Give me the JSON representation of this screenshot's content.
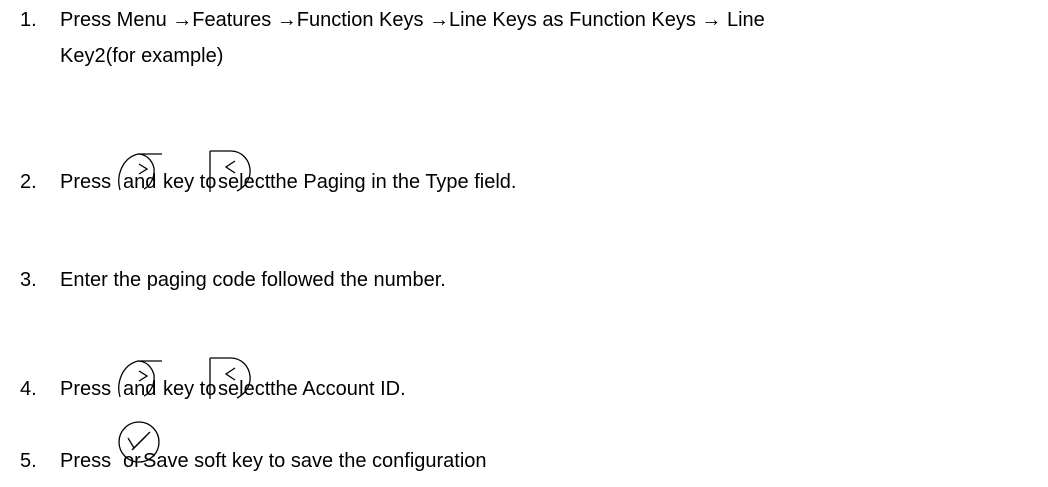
{
  "steps": [
    {
      "number": "1.",
      "line1": "Press Menu →Features →Function Keys →Line Keys as Function Keys → Line",
      "line2": "Key2(for example)"
    },
    {
      "number": "2.",
      "press": "Press",
      "and": "and",
      "key_to": "key to",
      "select": "select",
      "rest": "the Paging in the Type field.",
      "icons": [
        "right-navigation-key-icon",
        "left-navigation-key-icon"
      ]
    },
    {
      "number": "3.",
      "text": "Enter the paging code followed the number."
    },
    {
      "number": "4.",
      "press": "Press",
      "and": "and",
      "key_to": "key to",
      "select": "select",
      "rest": "the Account ID.",
      "icons": [
        "right-navigation-key-icon",
        "left-navigation-key-icon"
      ]
    },
    {
      "number": "5.",
      "press": "Press",
      "or": "or",
      "rest": "Save soft key to save the configuration",
      "icons": [
        "ok-key-icon"
      ]
    }
  ]
}
